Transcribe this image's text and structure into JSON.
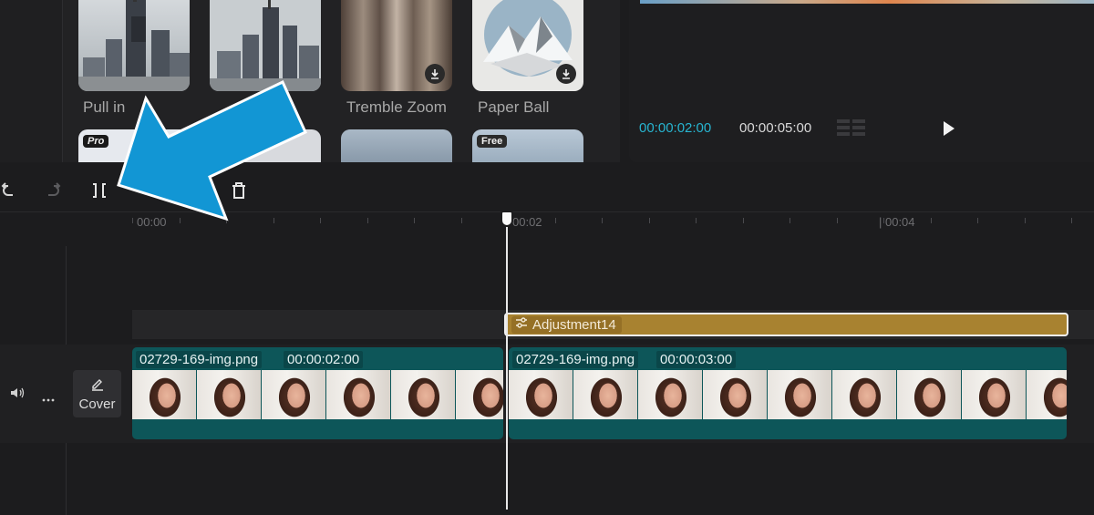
{
  "effects": {
    "items": [
      {
        "label": "Pull in",
        "has_download": false
      },
      {
        "label": "",
        "has_download": false
      },
      {
        "label": "Tremble Zoom",
        "has_download": true
      },
      {
        "label": "Paper Ball",
        "has_download": true
      }
    ],
    "row2_tags": {
      "pro": "Pro",
      "free": "Free"
    }
  },
  "player": {
    "current_time": "00:00:02:00",
    "total_time": "00:00:05:00"
  },
  "toolbar": {
    "icons": [
      "undo-icon",
      "redo-icon",
      "split-icon",
      "delete-icon"
    ]
  },
  "ruler": {
    "labels": [
      "00:00",
      "00:02",
      "| 00:04"
    ]
  },
  "timeline": {
    "adjustment_label": "Adjustment14",
    "clips": [
      {
        "name": "02729-169-img.png",
        "duration": "00:00:02:00"
      },
      {
        "name": "02729-169-img.png",
        "duration": "00:00:03:00"
      }
    ],
    "cover_label": "Cover",
    "playhead_time": "00:00:02:00"
  },
  "colors": {
    "accent": "#27b4d0",
    "adjustment_clip": "#a88230",
    "video_clip": "#0d5659",
    "annotation_arrow": "#1296d4"
  }
}
